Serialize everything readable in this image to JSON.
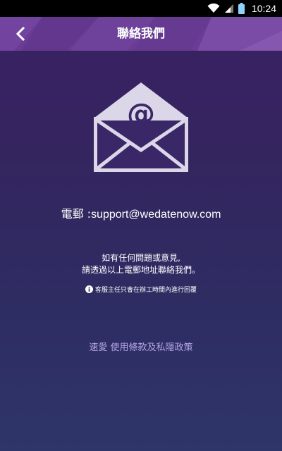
{
  "status_bar": {
    "time": "10:24",
    "wifi_icon": "wifi-icon",
    "signal_icon": "signal-icon",
    "battery_icon": "battery-icon"
  },
  "header": {
    "title": "聯絡我們",
    "back_icon": "chevron-left-icon",
    "color": "#6a3c95"
  },
  "content": {
    "envelope_icon": "envelope-at-icon",
    "email_label": "電郵 :",
    "email_value": "support@wedatenow.com",
    "message_line1": "如有任何問題或意見,",
    "message_line2": "請透過以上電郵地址聯絡我們。",
    "notice_icon": "info-icon",
    "notice_text": "客服主任只會在辦工時間內進行回覆",
    "policy_link": "速愛 使用條款及私隱政策"
  },
  "colors": {
    "background_top": "#3b2064",
    "background_bottom": "#2e3569",
    "link": "#b6a6e6"
  }
}
